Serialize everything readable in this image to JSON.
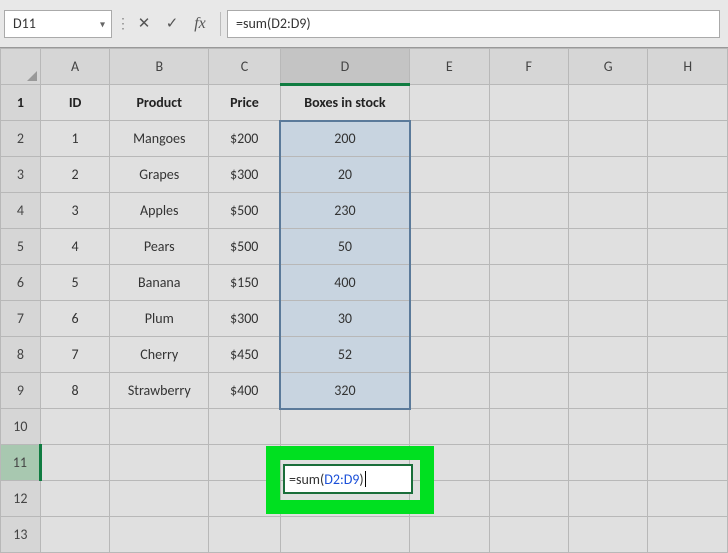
{
  "name_box": "D11",
  "formula_bar": "=sum(D2:D9)",
  "active_cell_formula_prefix": "=sum(",
  "active_cell_formula_ref": "D2:D9",
  "active_cell_formula_suffix": ")",
  "columns": [
    "A",
    "B",
    "C",
    "D",
    "E",
    "F",
    "G",
    "H"
  ],
  "row_numbers": [
    "1",
    "2",
    "3",
    "4",
    "5",
    "6",
    "7",
    "8",
    "9",
    "10",
    "11",
    "12",
    "13"
  ],
  "headers": {
    "A": "ID",
    "B": "Product",
    "C": "Price",
    "D": "Boxes in stock"
  },
  "rows": [
    {
      "id": "1",
      "product": "Mangoes",
      "price": "$200",
      "stock": "200"
    },
    {
      "id": "2",
      "product": "Grapes",
      "price": "$300",
      "stock": "20"
    },
    {
      "id": "3",
      "product": "Apples",
      "price": "$500",
      "stock": "230"
    },
    {
      "id": "4",
      "product": "Pears",
      "price": "$500",
      "stock": "50"
    },
    {
      "id": "5",
      "product": "Banana",
      "price": "$150",
      "stock": "400"
    },
    {
      "id": "6",
      "product": "Plum",
      "price": "$300",
      "stock": "30"
    },
    {
      "id": "7",
      "product": "Cherry",
      "price": "$450",
      "stock": "52"
    },
    {
      "id": "8",
      "product": "Strawberry",
      "price": "$400",
      "stock": "320"
    }
  ],
  "icons": {
    "cancel": "✕",
    "enter": "✓",
    "fx": "fx",
    "dropdown": "▾",
    "divider_dots": "⋮"
  }
}
